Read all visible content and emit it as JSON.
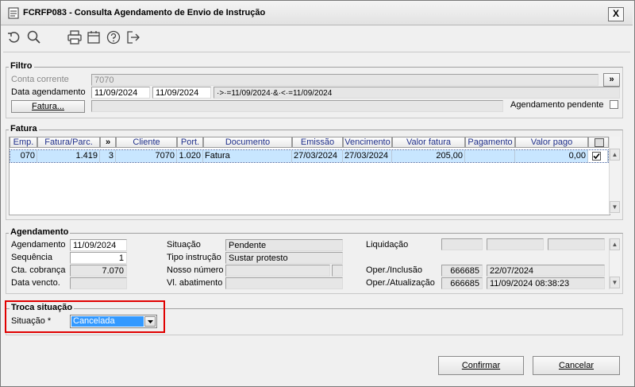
{
  "window": {
    "title": "FCRFP083 - Consulta Agendamento de Envio de Instrução",
    "close_label": "X"
  },
  "toolbar": {
    "icons": [
      "undo-icon",
      "search-icon",
      "print-icon",
      "calendar-icon",
      "help-icon",
      "exit-icon"
    ]
  },
  "filtro": {
    "title": "Filtro",
    "conta_label": "Conta corrente",
    "conta_value": "7070",
    "more_btn": "»",
    "data_label": "Data agendamento",
    "data_from": "11/09/2024",
    "data_to": "11/09/2024",
    "data_expr": "·>·=11/09/2024·&·<·=11/09/2024",
    "fatura_btn": "Fatura...",
    "fatura_value": "",
    "pendente_label": "Agendamento pendente"
  },
  "fatura": {
    "title": "Fatura",
    "columns": [
      "Emp.",
      "Fatura/Parc.",
      "»",
      "Cliente",
      "Port.",
      "Documento",
      "Emissão",
      "Vencimento",
      "Valor fatura",
      "Pagamento",
      "Valor pago"
    ],
    "row": {
      "emp": "070",
      "fatura": "1.419",
      "parc": "3",
      "cliente": "7070",
      "port": "1.020",
      "documento": "Fatura",
      "emissao": "27/03/2024",
      "vencimento": "27/03/2024",
      "valor_fatura": "205,00",
      "pagamento": "",
      "valor_pago": "0,00"
    }
  },
  "agendamento": {
    "title": "Agendamento",
    "agendamento_label": "Agendamento",
    "agendamento_value": "11/09/2024",
    "sequencia_label": "Sequência",
    "sequencia_value": "1",
    "cta_label": "Cta. cobrança",
    "cta_value": "7.070",
    "data_vencto_label": "Data vencto.",
    "data_vencto_value": "",
    "situacao_label": "Situação",
    "situacao_value": "Pendente",
    "tipo_label": "Tipo instrução",
    "tipo_value": "Sustar protesto",
    "nosso_label": "Nosso número",
    "nosso_value": "",
    "vl_label": "Vl. abatimento",
    "vl_value": "",
    "liquidacao_label": "Liquidação",
    "oper_inc_label": "Oper./Inclusão",
    "oper_inc_user": "666685",
    "oper_inc_date": "22/07/2024",
    "oper_atu_label": "Oper./Atualização",
    "oper_atu_user": "666685",
    "oper_atu_date": "11/09/2024 08:38:23"
  },
  "troca": {
    "title": "Troca situação",
    "situacao_label": "Situação *",
    "situacao_value": "Cancelada"
  },
  "actions": {
    "confirmar": "Confirmar",
    "cancelar": "Cancelar"
  },
  "colors": {
    "selection": "#3399ff",
    "row_highlight": "#c8e6ff",
    "header_text": "#1f2f8a",
    "highlight_border": "#e00000"
  }
}
